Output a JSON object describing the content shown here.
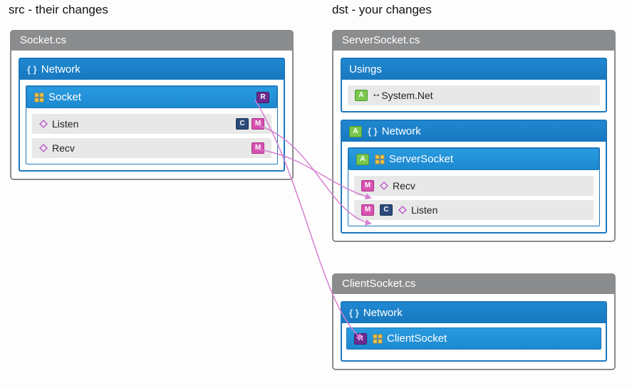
{
  "labels": {
    "src": "src - their changes",
    "dst": "dst - your changes"
  },
  "src": {
    "file": "Socket.cs",
    "namespace": "Network",
    "class": "Socket",
    "classBadge": "R",
    "members": [
      {
        "name": "Listen",
        "badges": [
          "C",
          "M"
        ]
      },
      {
        "name": "Recv",
        "badges": [
          "M"
        ]
      }
    ]
  },
  "dst": {
    "file1": {
      "name": "ServerSocket.cs",
      "usingsTitle": "Usings",
      "usings": [
        {
          "badge": "A",
          "name": "System.Net"
        }
      ],
      "nsBadge": "A",
      "namespace": "Network",
      "classBadge": "A",
      "class": "ServerSocket",
      "members": [
        {
          "badges": [
            "M"
          ],
          "name": "Recv"
        },
        {
          "badges": [
            "M",
            "C"
          ],
          "name": "Listen"
        }
      ]
    },
    "file2": {
      "name": "ClientSocket.cs",
      "namespace": "Network",
      "classBadge": "R",
      "class": "ClientSocket"
    }
  }
}
